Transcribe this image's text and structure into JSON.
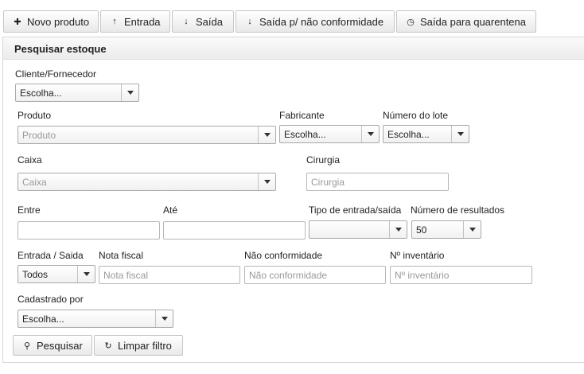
{
  "toolbar": {
    "new_product": {
      "label": "Novo produto",
      "icon": "plus-icon",
      "glyph": "✚"
    },
    "entry": {
      "label": "Entrada",
      "icon": "arrow-up-icon",
      "glyph": "↑"
    },
    "exit": {
      "label": "Saída",
      "icon": "arrow-down-icon",
      "glyph": "↓"
    },
    "exit_nonconformity": {
      "label": "Saída p/ não conformidade",
      "icon": "arrow-down-icon",
      "glyph": "↓"
    },
    "exit_quarantine": {
      "label": "Saída para quarentena",
      "icon": "clock-icon",
      "glyph": "◷"
    }
  },
  "panel": {
    "title": "Pesquisar estoque"
  },
  "form": {
    "client": {
      "label": "Cliente/Fornecedor",
      "value": "Escolha..."
    },
    "product": {
      "label": "Produto",
      "placeholder": "Produto"
    },
    "manufacturer": {
      "label": "Fabricante",
      "value": "Escolha..."
    },
    "lot_number": {
      "label": "Número do lote",
      "value": "Escolha..."
    },
    "box": {
      "label": "Caixa",
      "placeholder": "Caixa"
    },
    "surgery": {
      "label": "Cirurgia",
      "placeholder": "Cirurgia"
    },
    "from": {
      "label": "Entre",
      "value": ""
    },
    "to": {
      "label": "Até",
      "value": ""
    },
    "movement_type": {
      "label": "Tipo de entrada/saída",
      "value": ""
    },
    "results_count": {
      "label": "Número de resultados",
      "value": "50"
    },
    "direction": {
      "label": "Entrada / Saida",
      "value": "Todos"
    },
    "invoice": {
      "label": "Nota fiscal",
      "placeholder": "Nota fiscal"
    },
    "nonconformity": {
      "label": "Não conformidade",
      "placeholder": "Não conformidade"
    },
    "inventory_number": {
      "label": "Nº inventário",
      "placeholder": "Nº inventário"
    },
    "registered_by": {
      "label": "Cadastrado por",
      "value": "Escolha..."
    }
  },
  "actions": {
    "search": {
      "label": "Pesquisar",
      "icon": "search-icon",
      "glyph": "⚲"
    },
    "clear": {
      "label": "Limpar filtro",
      "icon": "refresh-icon",
      "glyph": "↻"
    }
  }
}
